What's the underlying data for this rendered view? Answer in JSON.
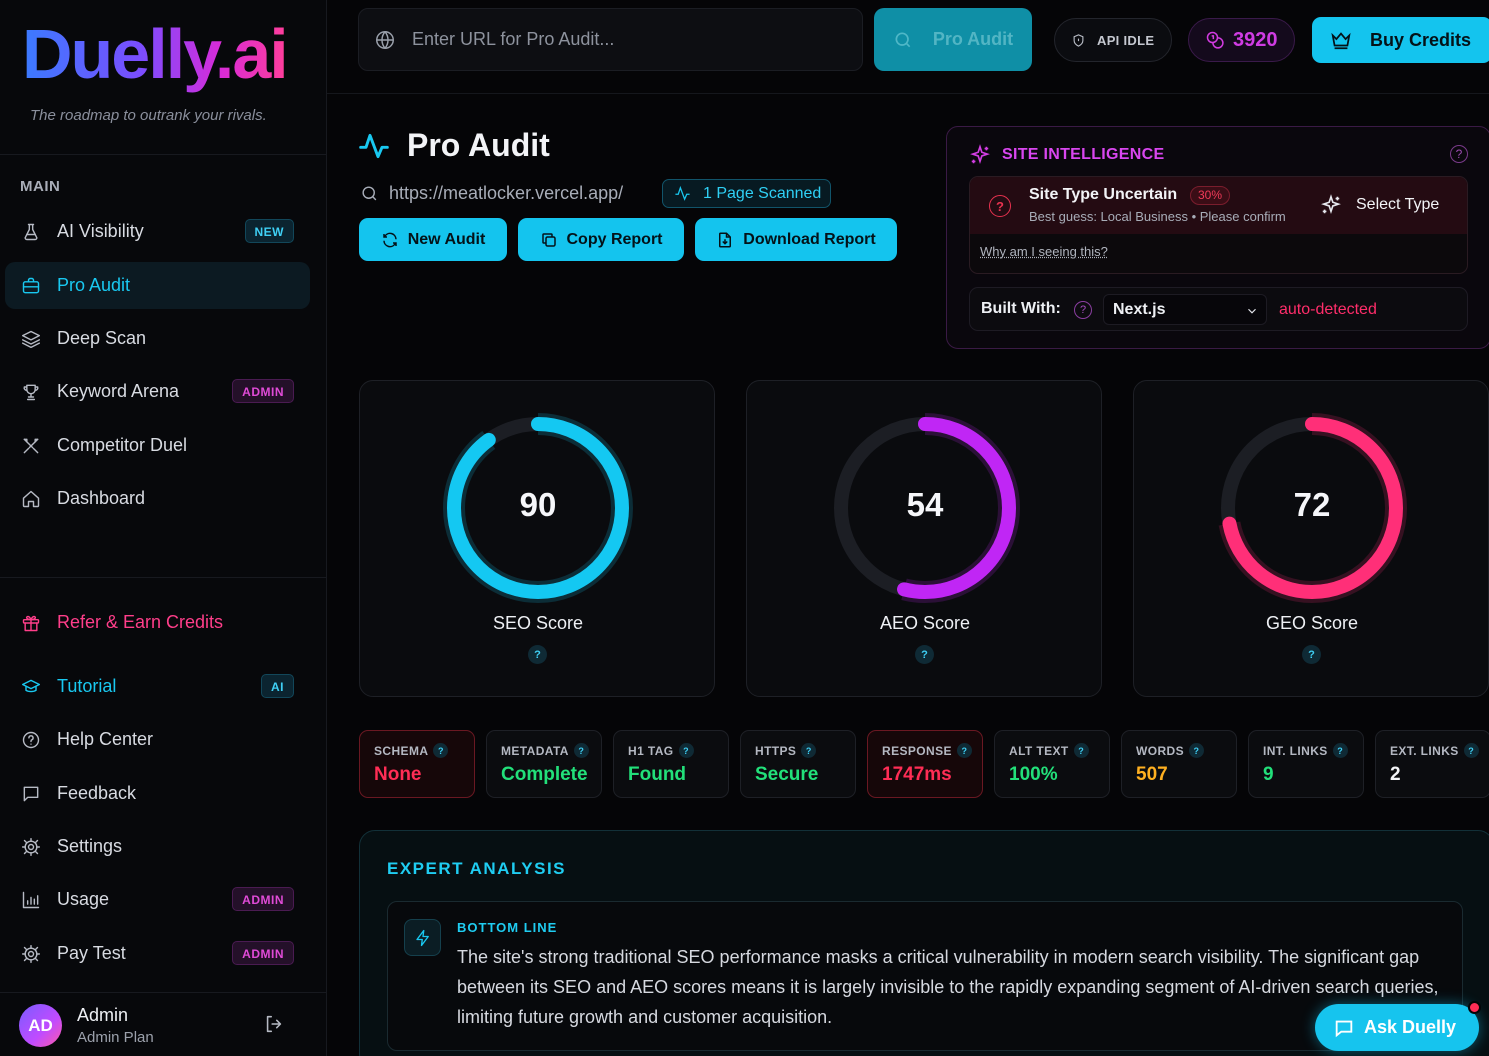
{
  "brand": {
    "logo_text": "Duelly.ai",
    "tagline": "The roadmap to outrank your rivals."
  },
  "sidebar": {
    "section_main": "MAIN",
    "items": [
      {
        "label": "AI Visibility",
        "icon": "flask-icon",
        "badge": "NEW"
      },
      {
        "label": "Pro Audit",
        "icon": "briefcase-icon",
        "active": true
      },
      {
        "label": "Deep Scan",
        "icon": "layers-icon"
      },
      {
        "label": "Keyword Arena",
        "icon": "trophy-icon",
        "badge": "ADMIN"
      },
      {
        "label": "Competitor Duel",
        "icon": "swords-icon"
      },
      {
        "label": "Dashboard",
        "icon": "home-icon"
      }
    ],
    "refer": {
      "label": "Refer & Earn Credits",
      "icon": "gift-icon"
    },
    "bottom_items": [
      {
        "label": "Tutorial",
        "icon": "graduation-cap-icon",
        "badge": "AI"
      },
      {
        "label": "Help Center",
        "icon": "help-circle-icon"
      },
      {
        "label": "Feedback",
        "icon": "message-square-icon"
      },
      {
        "label": "Settings",
        "icon": "gear-icon"
      },
      {
        "label": "Usage",
        "icon": "bar-chart-icon",
        "badge": "ADMIN"
      },
      {
        "label": "Pay Test",
        "icon": "gear-icon",
        "badge": "ADMIN"
      }
    ],
    "user": {
      "initials": "AD",
      "name": "Admin",
      "plan": "Admin Plan"
    }
  },
  "topbar": {
    "url_placeholder": "Enter URL for Pro Audit...",
    "audit_button": "Pro Audit",
    "api_status": "API IDLE",
    "credits": "3920",
    "buy_button": "Buy Credits"
  },
  "header": {
    "title": "Pro Audit",
    "site_url": "https://meatlocker.vercel.app/",
    "pages_scanned": "1 Page Scanned",
    "actions": {
      "new_audit": "New Audit",
      "copy_report": "Copy Report",
      "download_report": "Download Report"
    }
  },
  "site_intelligence": {
    "title": "SITE INTELLIGENCE",
    "help": "?",
    "status_title": "Site Type Uncertain",
    "confidence": "30%",
    "subtitle": "Best guess: Local Business • Please confirm",
    "select_type": "Select Type",
    "why_link": "Why am I seeing this?",
    "built_with_label": "Built With:",
    "built_with_value": "Next.js",
    "auto_detected": "auto-detected"
  },
  "scores": [
    {
      "label": "SEO Score",
      "value": "90",
      "fraction": 0.9,
      "color": "#14c8f2"
    },
    {
      "label": "AEO Score",
      "value": "54",
      "fraction": 0.54,
      "color": "#c026f5"
    },
    {
      "label": "GEO Score",
      "value": "72",
      "fraction": 0.72,
      "color": "#ff2f78"
    }
  ],
  "score_help": "?",
  "metrics": [
    {
      "label": "SCHEMA",
      "value": "None",
      "color": "#ff2d55",
      "status": "bad"
    },
    {
      "label": "METADATA",
      "value": "Complete",
      "color": "#22e07a"
    },
    {
      "label": "H1 TAG",
      "value": "Found",
      "color": "#22e07a"
    },
    {
      "label": "HTTPS",
      "value": "Secure",
      "color": "#22e07a"
    },
    {
      "label": "RESPONSE",
      "value": "1747ms",
      "color": "#ff2d55",
      "status": "bad"
    },
    {
      "label": "ALT TEXT",
      "value": "100%",
      "color": "#22e07a"
    },
    {
      "label": "WORDS",
      "value": "507",
      "color": "#ffb020"
    },
    {
      "label": "INT. LINKS",
      "value": "9",
      "color": "#22e07a"
    },
    {
      "label": "EXT. LINKS",
      "value": "2",
      "color": "#f3f4f7"
    }
  ],
  "expert_analysis": {
    "title": "EXPERT ANALYSIS",
    "bottom_line_title": "BOTTOM LINE",
    "bottom_line_text": "The site's strong traditional SEO performance masks a critical vulnerability in modern search visibility. The significant gap between its SEO and AEO scores means it is largely invisible to the rapidly expanding segment of AI-driven search queries, limiting future growth and customer acquisition."
  },
  "ask_button": "Ask Duelly"
}
